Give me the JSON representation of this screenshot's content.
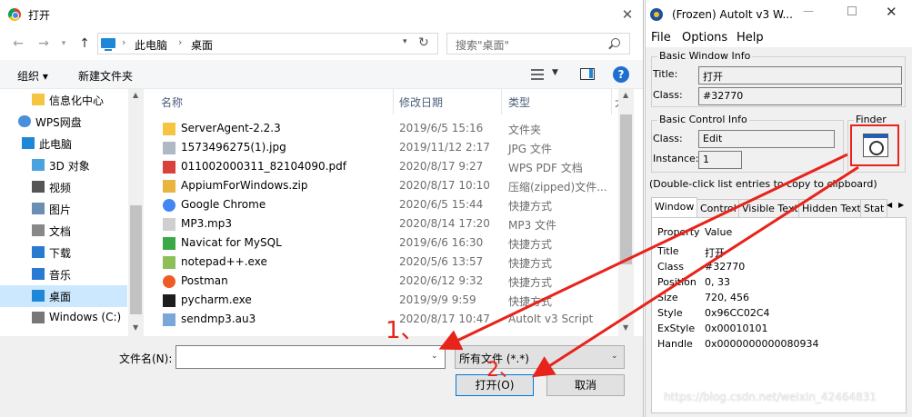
{
  "dialog": {
    "title": "打开",
    "address": {
      "crumbs": [
        "此电脑",
        "桌面"
      ]
    },
    "search": {
      "placeholder": "搜索\"桌面\""
    },
    "toolbar": {
      "organize": "组织 ▾",
      "new_folder": "新建文件夹"
    },
    "sidebar": [
      {
        "label": "信息化中心",
        "icon": "folder-icon"
      },
      {
        "label": "WPS网盘",
        "icon": "cloud-icon"
      },
      {
        "label": "此电脑",
        "icon": "computer-icon"
      },
      {
        "label": "3D 对象",
        "icon": "cube-icon"
      },
      {
        "label": "视频",
        "icon": "video-icon"
      },
      {
        "label": "图片",
        "icon": "picture-icon"
      },
      {
        "label": "文档",
        "icon": "document-icon"
      },
      {
        "label": "下载",
        "icon": "download-icon"
      },
      {
        "label": "音乐",
        "icon": "music-icon"
      },
      {
        "label": "桌面",
        "icon": "desktop-icon",
        "selected": true
      },
      {
        "label": "Windows (C:)",
        "icon": "drive-icon"
      }
    ],
    "columns": [
      "名称",
      "修改日期",
      "类型",
      "大"
    ],
    "files": [
      {
        "name": "ServerAgent-2.2.3",
        "date": "2019/6/5 15:16",
        "type": "文件夹",
        "icon": "folder-icon"
      },
      {
        "name": "1573496275(1).jpg",
        "date": "2019/11/12 2:17",
        "type": "JPG 文件",
        "icon": "image-file-icon"
      },
      {
        "name": "011002000311_82104090.pdf",
        "date": "2020/8/17 9:27",
        "type": "WPS PDF 文档",
        "icon": "pdf-icon"
      },
      {
        "name": "AppiumForWindows.zip",
        "date": "2020/8/17 10:10",
        "type": "压缩(zipped)文件...",
        "icon": "zip-icon"
      },
      {
        "name": "Google Chrome",
        "date": "2020/6/5 15:44",
        "type": "快捷方式",
        "icon": "chrome-icon"
      },
      {
        "name": "MP3.mp3",
        "date": "2020/8/14 17:20",
        "type": "MP3 文件",
        "icon": "audio-file-icon"
      },
      {
        "name": "Navicat for MySQL",
        "date": "2019/6/6 16:30",
        "type": "快捷方式",
        "icon": "navicat-icon"
      },
      {
        "name": "notepad++.exe",
        "date": "2020/5/6 13:57",
        "type": "快捷方式",
        "icon": "notepad-icon"
      },
      {
        "name": "Postman",
        "date": "2020/6/12 9:32",
        "type": "快捷方式",
        "icon": "postman-icon"
      },
      {
        "name": "pycharm.exe",
        "date": "2019/9/9 9:59",
        "type": "快捷方式",
        "icon": "pycharm-icon"
      },
      {
        "name": "sendmp3.au3",
        "date": "2020/8/17 10:47",
        "type": "AutoIt v3 Script",
        "icon": "script-icon"
      }
    ],
    "bottom": {
      "filename_label": "文件名(N):",
      "filename_value": "",
      "filetype": "所有文件 (*.*)",
      "open": "打开(O)",
      "cancel": "取消"
    }
  },
  "autoit": {
    "title": "(Frozen) AutoIt v3 W...",
    "menu": [
      "File",
      "Options",
      "Help"
    ],
    "basic_window": {
      "heading": "Basic Window Info",
      "title_label": "Title:",
      "title_value": "打开",
      "class_label": "Class:",
      "class_value": "#32770"
    },
    "basic_control": {
      "heading": "Basic Control Info",
      "class_label": "Class:",
      "class_value": "Edit",
      "instance_label": "Instance:",
      "instance_value": "1"
    },
    "finder_tool": "Finder Tool",
    "hint": "(Double-click list entries to copy to clipboard)",
    "tabs": [
      "Window",
      "Control",
      "Visible Text",
      "Hidden Text",
      "Stat"
    ],
    "props_header": {
      "key": "Property",
      "value": "Value"
    },
    "props": [
      {
        "key": "Title",
        "value": "打开"
      },
      {
        "key": "Class",
        "value": "#32770"
      },
      {
        "key": "Position",
        "value": "0, 33"
      },
      {
        "key": "Size",
        "value": "720, 456"
      },
      {
        "key": "Style",
        "value": "0x96CC02C4"
      },
      {
        "key": "ExStyle",
        "value": "0x00010101"
      },
      {
        "key": "Handle",
        "value": "0x0000000000080934"
      }
    ]
  },
  "annotations": {
    "mark1": "1、",
    "mark2": "2、",
    "color": "#e8231b"
  },
  "watermark": "https://blog.csdn.net/weixin_42464831"
}
